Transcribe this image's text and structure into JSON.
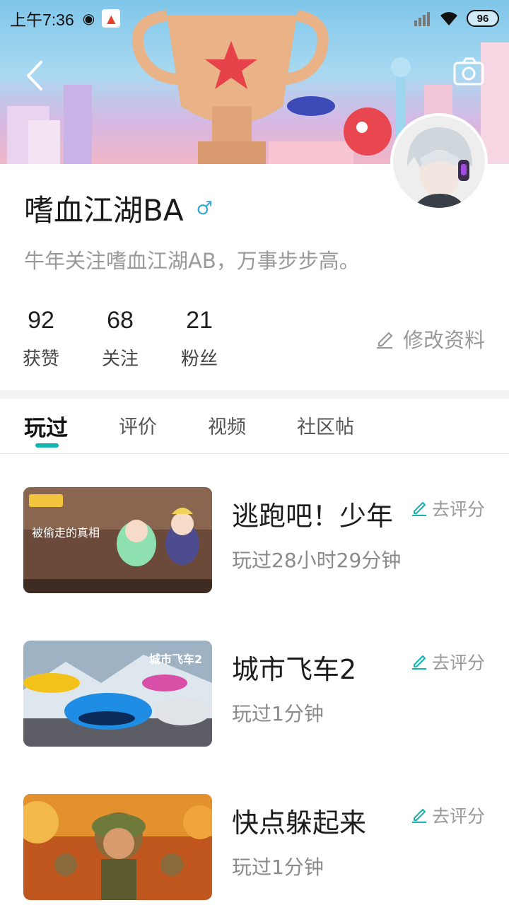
{
  "status_bar": {
    "time": "上午7:36",
    "battery": "96"
  },
  "profile": {
    "name": "嗜血江湖BA",
    "gender_symbol": "♂",
    "bio": "牛年关注嗜血江湖AB，万事步步高。",
    "stats": [
      {
        "value": "92",
        "label": "获赞"
      },
      {
        "value": "68",
        "label": "关注"
      },
      {
        "value": "21",
        "label": "粉丝"
      }
    ],
    "edit_label": "修改资料"
  },
  "tabs": [
    {
      "label": "玩过",
      "active": true
    },
    {
      "label": "评价",
      "active": false
    },
    {
      "label": "视频",
      "active": false
    },
    {
      "label": "社区帖",
      "active": false
    }
  ],
  "games": [
    {
      "title": "逃跑吧！少年",
      "playtime": "玩过28小时29分钟",
      "rate_label": "去评分",
      "thumb_text": "被偷走的真相"
    },
    {
      "title": "城市飞车2",
      "playtime": "玩过1分钟",
      "rate_label": "去评分",
      "thumb_text": "城市飞车2"
    },
    {
      "title": "快点躲起来",
      "playtime": "玩过1分钟",
      "rate_label": "去评分",
      "thumb_text": ""
    }
  ],
  "colors": {
    "accent": "#13b5b1",
    "gender": "#3aa6d8"
  },
  "icons": [
    "back-icon",
    "camera-icon",
    "edit-icon",
    "rate-pen-icon",
    "wifi-icon",
    "signal-icon"
  ]
}
